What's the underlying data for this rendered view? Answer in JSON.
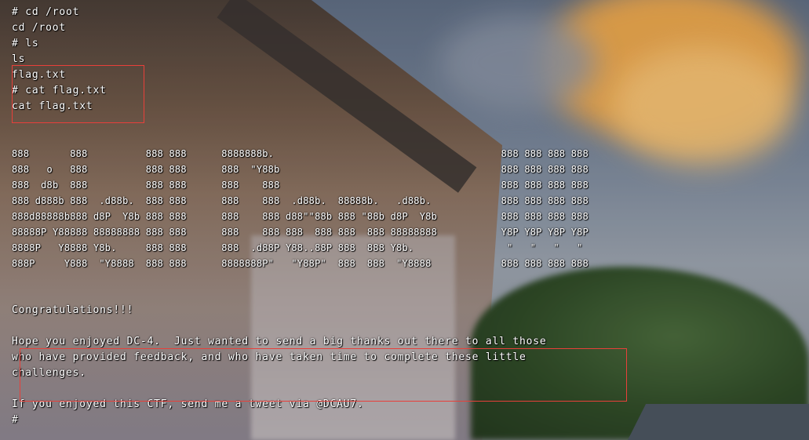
{
  "terminal": {
    "commands": [
      "# cd /root",
      "cd /root",
      "# ls",
      "ls",
      "flag.txt",
      "# cat flag.txt",
      "cat flag.txt"
    ],
    "banner": [
      "888       888          888 888      8888888b.                                       888 888 888 888",
      "888   o   888          888 888      888  \"Y88b                                      888 888 888 888",
      "888  d8b  888          888 888      888    888                                      888 888 888 888",
      "888 d888b 888  .d88b.  888 888      888    888  .d88b.  88888b.   .d88b.            888 888 888 888",
      "888d88888b888 d8P  Y8b 888 888      888    888 d88\"\"88b 888 \"88b d8P  Y8b           888 888 888 888",
      "88888P Y88888 88888888 888 888      888    888 888  888 888  888 88888888           Y8P Y8P Y8P Y8P",
      "8888P   Y8888 Y8b.     888 888      888  .d88P Y88..88P 888  888 Y8b.                \"   \"   \"   \"",
      "888P     Y888  \"Y8888  888 888      8888888P\"   \"Y88P\"  888  888  \"Y8888            888 888 888 888"
    ],
    "congrats": "Congratulations!!!",
    "message": [
      "Hope you enjoyed DC-4.  Just wanted to send a big thanks out there to all those",
      "who have provided feedback, and who have taken time to complete these little",
      "challenges."
    ],
    "tweet": "If you enjoyed this CTF, send me a tweet via @DCAU7.",
    "prompt": "#"
  },
  "colors": {
    "text": "#ffffff",
    "highlight_border": "#e8403a"
  }
}
